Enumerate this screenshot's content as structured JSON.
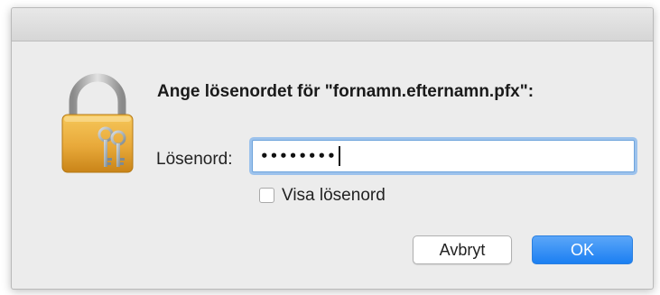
{
  "dialog": {
    "prompt": "Ange lösenordet för \"fornamn.efternamn.pfx\":",
    "password_label": "Lösenord:",
    "password_value": "••••••••",
    "show_password_label": "Visa lösenord",
    "show_password_checked": false,
    "cancel_label": "Avbryt",
    "ok_label": "OK"
  },
  "icons": {
    "lock": "padlock-with-keys-icon"
  },
  "colors": {
    "accent": "#1b7ff2",
    "focus_ring": "#9cc2ec",
    "lock_gold": "#e8a93a"
  }
}
